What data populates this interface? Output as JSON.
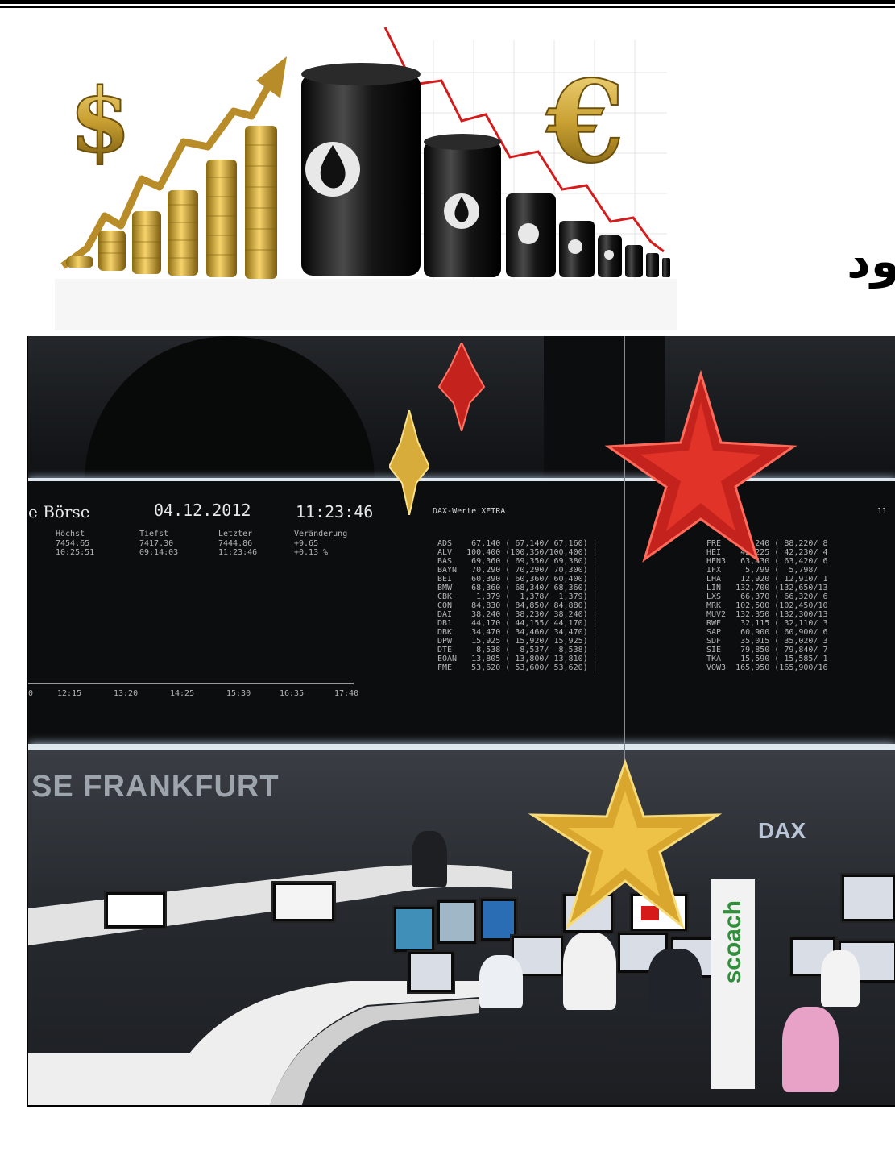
{
  "headline": {
    "text": "ود"
  },
  "illustration": {
    "dollar_symbol": "$",
    "euro_symbol": "€",
    "icons": [
      "dollar-sign-icon",
      "gold-coin-stacks-icon",
      "rising-arrow-icon",
      "oil-barrel-icon",
      "oil-drop-icon",
      "falling-line-icon",
      "euro-sign-icon"
    ]
  },
  "photo": {
    "board": {
      "left_title": "e Börse",
      "date": "04.12.2012",
      "time": "11:23:46",
      "col_headers": [
        "Höchst",
        "Tiefst",
        "Letzter",
        "Veränderung"
      ],
      "row1": [
        "7454.65",
        "7417.30",
        "7444.86",
        "+9.65"
      ],
      "row2": [
        "10:25:51",
        "09:14:03",
        "11:23:46",
        "+0.13 %"
      ],
      "time_axis": [
        "0",
        "12:15",
        "13:20",
        "14:25",
        "15:30",
        "16:35",
        "17:40"
      ],
      "right_title": "DAX-Werte XETRA",
      "right_clock": "11",
      "left_list": "ADS    67,140 ( 67,140/ 67,160) |\nALV   100,400 (100,350/100,400) |\nBAS    69,360 ( 69,350/ 69,380) |\nBAYN   70,290 ( 70,290/ 70,300) |\nBEI    60,390 ( 60,360/ 60,400) |\nBMW    68,360 ( 68,340/ 68,360) |\nCBK     1,379 (  1,378/  1,379) |\nCON    84,830 ( 84,850/ 84,880) |\nDAI    38,240 ( 38,230/ 38,240) |\nDB1    44,170 ( 44,155/ 44,170) |\nDBK    34,470 ( 34,460/ 34,470) |\nDPW    15,925 ( 15,920/ 15,925) |\nDTE     8,538 (  8,537/  8,538) |\nEOAN   13,805 ( 13,800/ 13,810) |\nFME    53,620 ( 53,600/ 53,620) |",
      "right_list": "FRE    88,240 ( 88,220/ 8\nHEI    42,225 ( 42,230/ 4\nHEN3   63,430 ( 63,420/ 6\nIFX     5,799 (  5,798/\nLHA    12,920 ( 12,910/ 1\nLIN   132,700 (132,650/13\nLXS    66,370 ( 66,320/ 6\nMRK   102,500 (102,450/10\nMUV2  132,350 (132,300/13\nRWE    32,115 ( 32,110/ 3\nSAP    60,900 ( 60,900/ 6\nSDF    35,015 ( 35,020/ 3\nSIE    79,850 ( 79,840/ 7\nTKA    15,590 ( 15,585/ 1\nVOW3  165,950 (165,900/16"
    },
    "wall_sign": "SE FRANKFURT",
    "dax_logo": "DAX",
    "banner_text": "scoach"
  }
}
